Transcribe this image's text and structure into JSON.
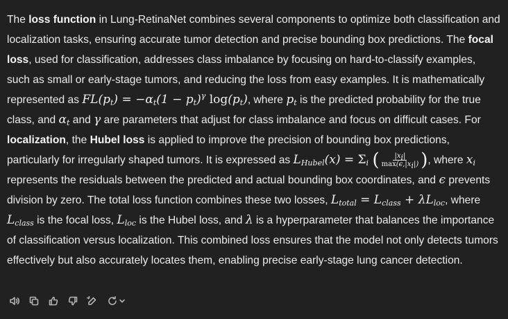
{
  "message": {
    "s1": "The ",
    "b_loss_function": "loss function",
    "s2": " in Lung-RetinaNet combines several components to optimize both classification and localization tasks, ensuring accurate tumor detection and precise bounding box predictions. The ",
    "b_focal_loss": "focal loss",
    "s3": ", used for classification, addresses class imbalance by focusing on hard-to-classify examples, such as small or early-stage tumors, and reducing the loss from easy examples. It is mathematically represented as ",
    "focal_eq": "FL(pt) = −αt(1 − pt)γ log(pt)",
    "s4": ", where ",
    "pt": "pt",
    "s5": " is the predicted probability for the true class, and ",
    "alpha_t": "αt",
    "s6": " and ",
    "gamma": "γ",
    "s7": " are parameters that adjust for class imbalance and focus on difficult cases. For ",
    "b_localization": "localization",
    "s8": ", the ",
    "b_hubel_loss": "Hubel loss",
    "s9": " is applied to improve the precision of bounding box predictions, particularly for irregularly shaped tumors. It is expressed as ",
    "hubel_eq": "LHubel(x) = Σi (|xi| / max(ϵ,|xi|))",
    "s10": ", where ",
    "xi": "xi",
    "s11": " represents the residuals between the predicted and actual bounding box coordinates, and ",
    "epsilon": "ϵ",
    "s12": " prevents division by zero. The total loss function combines these two losses, ",
    "total_eq": "Ltotal = Lclass + λLloc",
    "s13": ", where ",
    "lclass": "Lclass",
    "s14": " is the focal loss, ",
    "lloc": "Lloc",
    "s15": " is the Hubel loss, and ",
    "lambda": "λ",
    "s16": " is a hyperparameter that balances the importance of classification versus localization. This combined loss ensures that the model not only detects tumors effectively but also accurately locates them, enabling precise early-stage lung cancer detection."
  },
  "toolbar": {
    "icons": [
      "speaker-icon",
      "copy-icon",
      "thumbs-up-icon",
      "thumbs-down-icon",
      "edit-icon",
      "regenerate-icon"
    ]
  }
}
